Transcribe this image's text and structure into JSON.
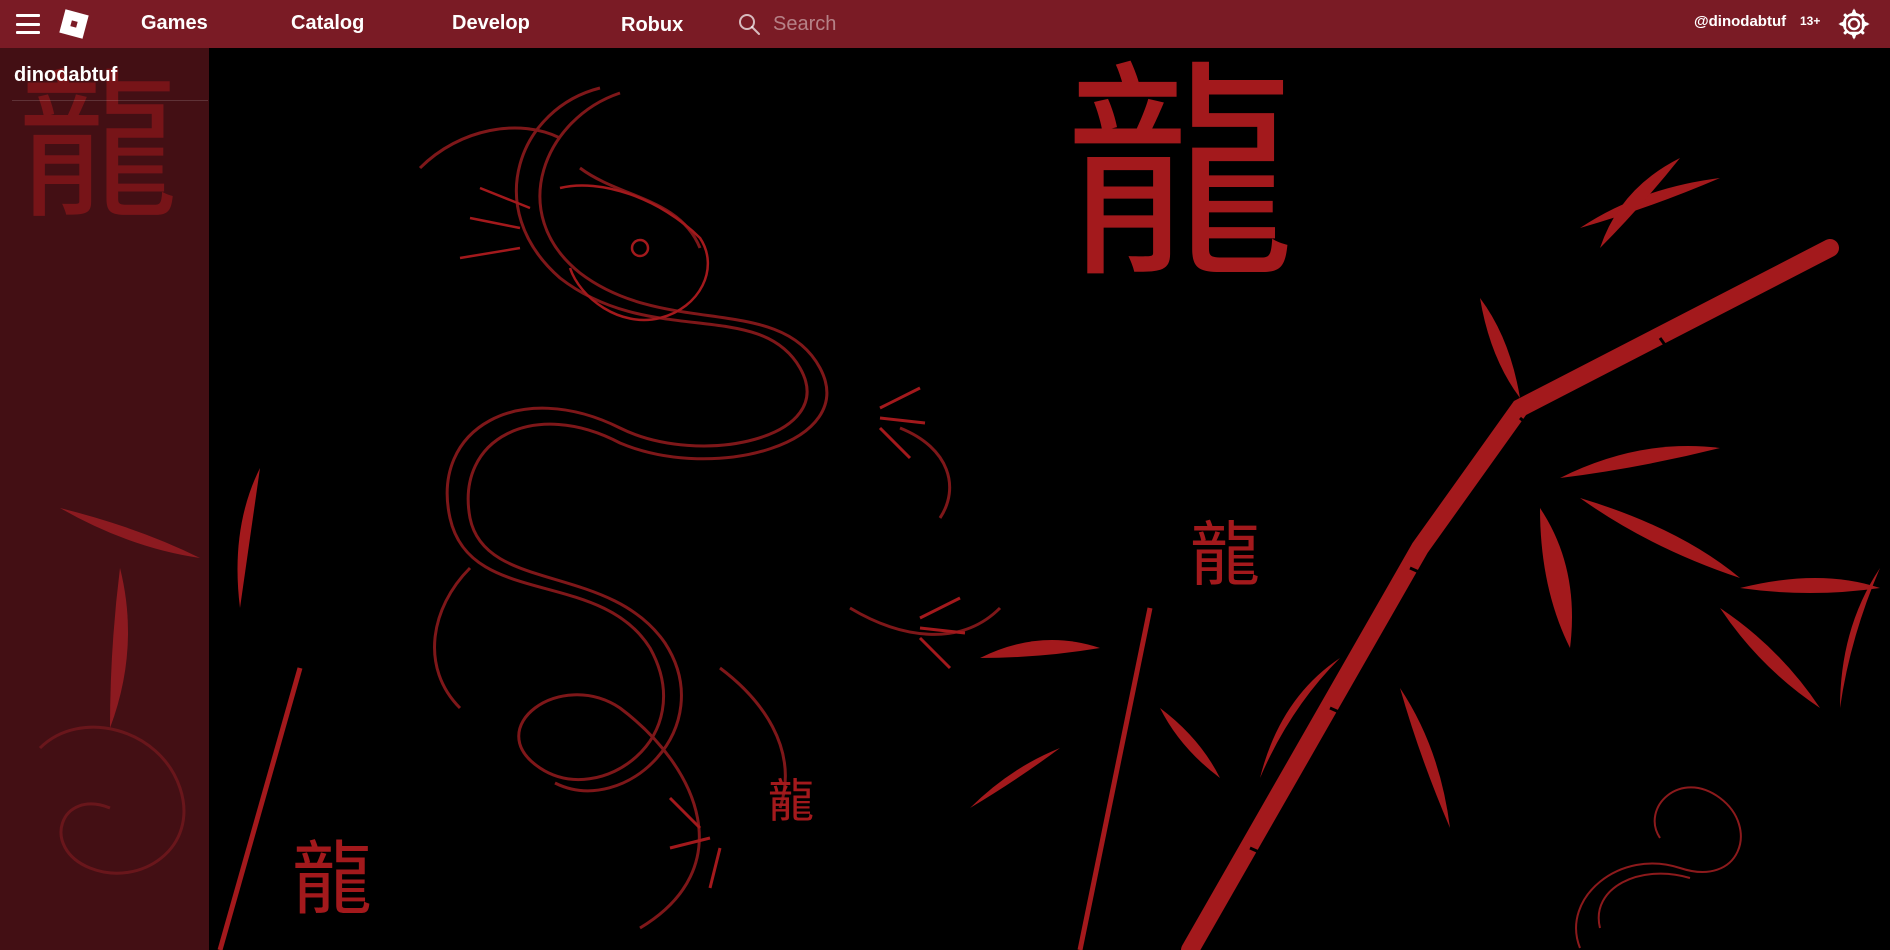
{
  "header": {
    "nav": [
      {
        "label": "Games"
      },
      {
        "label": "Catalog"
      },
      {
        "label": "Develop"
      },
      {
        "label": "Robux"
      }
    ],
    "search": {
      "placeholder": "Search",
      "value": ""
    },
    "username_link": "@dinodabtuf",
    "age_badge": "13+"
  },
  "sidebar": {
    "username": "dinodabtuf"
  },
  "background": {
    "glyphs": [
      "龍",
      "龍",
      "龍",
      "龍",
      "龍",
      "龍"
    ],
    "colors": {
      "art_red": "#a3191c",
      "topbar": "#7a1b25",
      "base": "#000000"
    }
  },
  "icons": {
    "menu": "hamburger-menu-icon",
    "logo": "roblox-logo-icon",
    "search": "search-icon",
    "settings": "gear-icon"
  }
}
